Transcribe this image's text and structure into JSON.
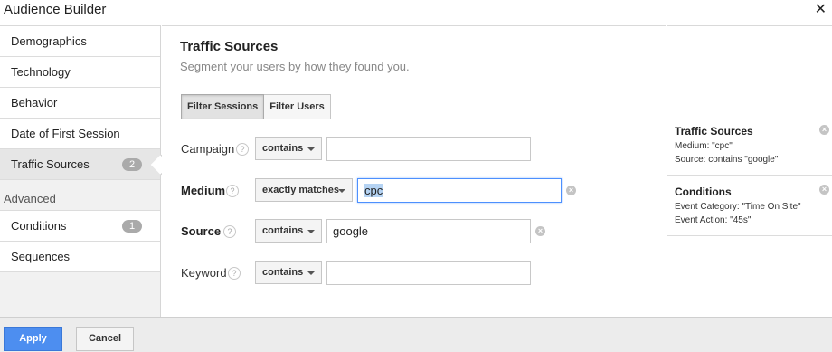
{
  "window": {
    "title": "Audience Builder",
    "close_glyph": "✕"
  },
  "sidebar": {
    "items": [
      {
        "label": "Demographics",
        "badge": ""
      },
      {
        "label": "Technology",
        "badge": ""
      },
      {
        "label": "Behavior",
        "badge": ""
      },
      {
        "label": "Date of First Session",
        "badge": ""
      },
      {
        "label": "Traffic Sources",
        "badge": "2",
        "active": true
      }
    ],
    "section_label": "Advanced",
    "advanced_items": [
      {
        "label": "Conditions",
        "badge": "1"
      },
      {
        "label": "Sequences",
        "badge": ""
      }
    ]
  },
  "main": {
    "title": "Traffic Sources",
    "subtitle": "Segment your users by how they found you.",
    "toggle": {
      "sessions_label": "Filter Sessions",
      "users_label": "Filter Users",
      "selected": "Filter Sessions"
    },
    "help_glyph": "?",
    "remove_glyph": "×",
    "filters": [
      {
        "label": "Campaign",
        "operator": "contains",
        "value": ""
      },
      {
        "label": "Medium",
        "operator": "exactly matches",
        "value": "cpc"
      },
      {
        "label": "Source",
        "operator": "contains",
        "value": "google"
      },
      {
        "label": "Keyword",
        "operator": "contains",
        "value": ""
      }
    ]
  },
  "summary": {
    "blocks": [
      {
        "title": "Traffic Sources",
        "lines": [
          "Medium: \"cpc\"",
          "Source: contains \"google\""
        ]
      },
      {
        "title": "Conditions",
        "lines": [
          "Event Category: \"Time On Site\"",
          "Event Action: \"45s\""
        ]
      }
    ]
  },
  "footer": {
    "apply_label": "Apply",
    "cancel_label": "Cancel"
  },
  "colors": {
    "accent": "#4d8ef0",
    "selection": "#b5d3f3",
    "focus_border": "#4d90fe"
  }
}
